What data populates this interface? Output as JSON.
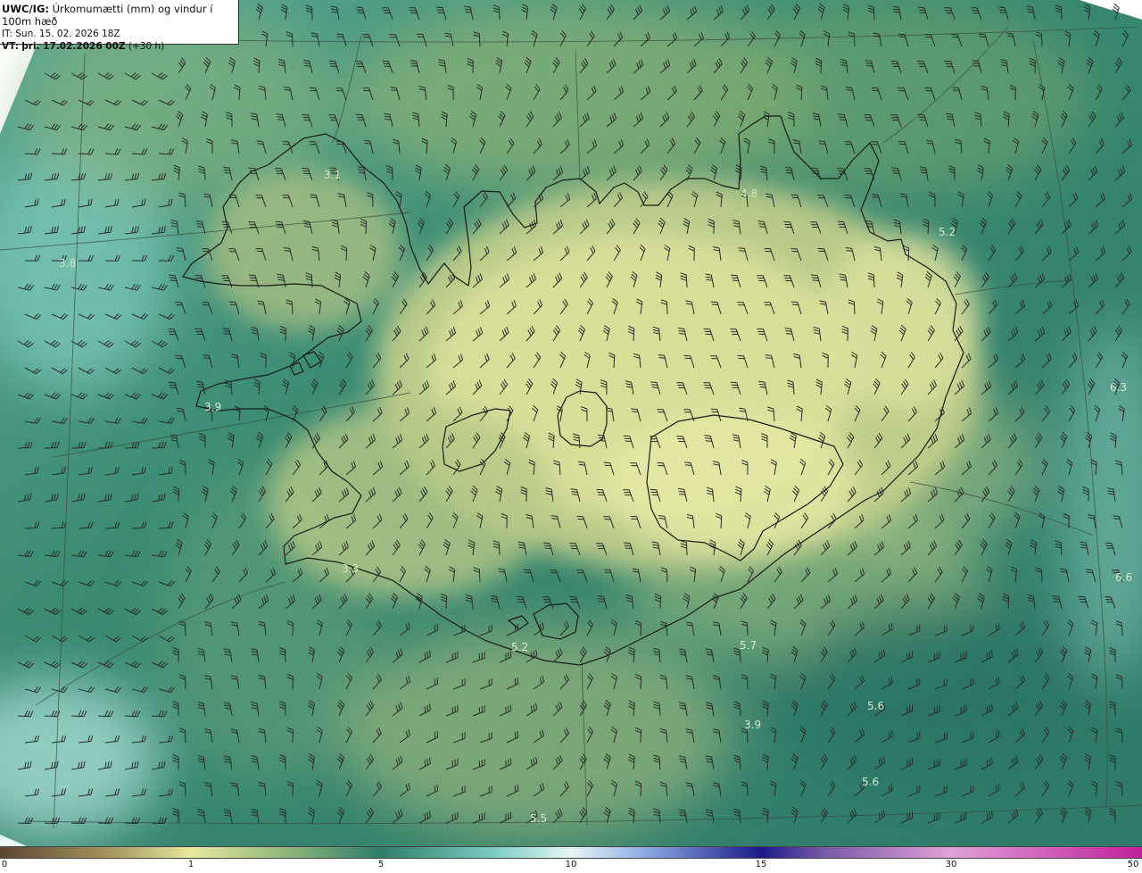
{
  "header": {
    "model_label": "UWC/IG:",
    "title": "Úrkomumætti (mm) og vindur í 100m hæð",
    "it_label": "IT:",
    "it_value": "Sun. 15. 02. 2026 18Z",
    "vt_label": "VT:",
    "vt_value": "þri. 17.02.2026 00Z",
    "vt_offset": "(+30 h)"
  },
  "colorbar": {
    "ticks": [
      "0",
      "1",
      "5",
      "10",
      "15",
      "30",
      "50"
    ],
    "stops": [
      {
        "v": 0,
        "c": "#5a4632"
      },
      {
        "v": 0.6,
        "c": "#a89a60"
      },
      {
        "v": 1,
        "c": "#e8e8a0"
      },
      {
        "v": 3,
        "c": "#8fb67a"
      },
      {
        "v": 5,
        "c": "#2e7d6a"
      },
      {
        "v": 8,
        "c": "#7ccdc4"
      },
      {
        "v": 10,
        "c": "#e6f6f6"
      },
      {
        "v": 12,
        "c": "#8aa8e0"
      },
      {
        "v": 15,
        "c": "#1a1a8a"
      },
      {
        "v": 20,
        "c": "#7a5aa8"
      },
      {
        "v": 30,
        "c": "#e0a0d8"
      },
      {
        "v": 50,
        "c": "#c0209a"
      }
    ]
  },
  "map_values": [
    {
      "v": "3.1"
    },
    {
      "v": "4.8"
    },
    {
      "v": "5.2"
    },
    {
      "v": "3.8"
    },
    {
      "v": "6.3"
    },
    {
      "v": "3.9"
    },
    {
      "v": "3.3"
    },
    {
      "v": "6.6"
    },
    {
      "v": "5.2"
    },
    {
      "v": "5.7"
    },
    {
      "v": "5.6"
    },
    {
      "v": "3.9"
    },
    {
      "v": "5.6"
    },
    {
      "v": "5.5"
    }
  ],
  "colors": {
    "sea_dark": "#2f7a68",
    "land_light": "#dfe39a",
    "coast": "#1a1a1a",
    "barb": "#2b2b2b"
  }
}
